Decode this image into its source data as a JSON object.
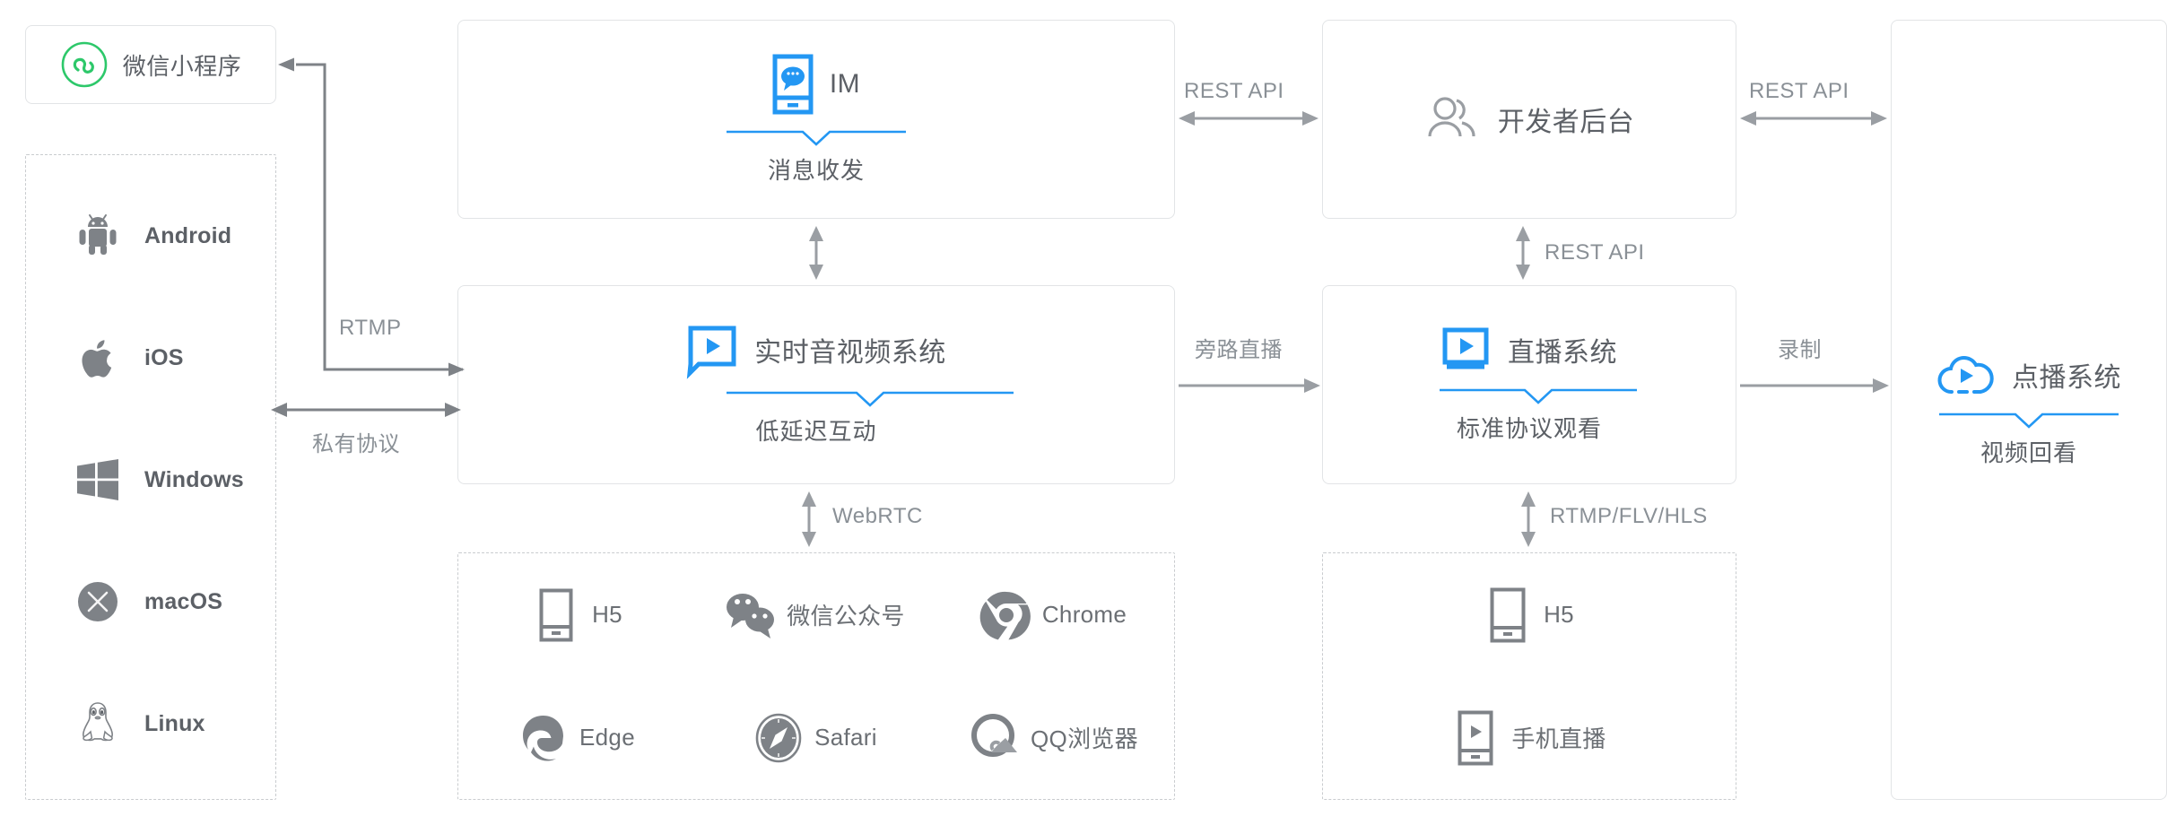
{
  "wechat_mini": {
    "label": "微信小程序",
    "icon": "wechat-miniprogram-icon",
    "accent": "#2dc86a"
  },
  "platforms": [
    {
      "label": "Android",
      "icon": "android-icon"
    },
    {
      "label": "iOS",
      "icon": "apple-icon"
    },
    {
      "label": "Windows",
      "icon": "windows-icon"
    },
    {
      "label": "macOS",
      "icon": "macos-icon"
    },
    {
      "label": "Linux",
      "icon": "linux-icon"
    }
  ],
  "modules": {
    "im": {
      "title": "IM",
      "subtitle": "消息收发",
      "icon": "im-phone-chat-icon"
    },
    "rtc": {
      "title": "实时音视频系统",
      "subtitle": "低延迟互动",
      "icon": "rtc-play-bubble-icon"
    },
    "dev": {
      "title": "开发者后台",
      "subtitle": "",
      "icon": "users-icon"
    },
    "live": {
      "title": "直播系统",
      "subtitle": "标准协议观看",
      "icon": "live-play-icon"
    },
    "vod": {
      "title": "点播系统",
      "subtitle": "视频回看",
      "icon": "cloud-play-icon"
    }
  },
  "browser_clients": [
    {
      "label": "H5",
      "icon": "phone-icon"
    },
    {
      "label": "微信公众号",
      "icon": "wechat-official-icon"
    },
    {
      "label": "Chrome",
      "icon": "chrome-icon"
    },
    {
      "label": "Edge",
      "icon": "edge-icon"
    },
    {
      "label": "Safari",
      "icon": "safari-icon"
    },
    {
      "label": "QQ浏览器",
      "icon": "qq-browser-icon"
    }
  ],
  "mobile_clients": [
    {
      "label": "H5",
      "icon": "phone-icon"
    },
    {
      "label": "手机直播",
      "icon": "phone-live-icon"
    }
  ],
  "connectors": {
    "rtmp": "RTMP",
    "private_protocol": "私有协议",
    "im_dev_rest": "REST API",
    "dev_vod_rest": "REST API",
    "dev_live_rest": "REST API",
    "bypass_live": "旁路直播",
    "record": "录制",
    "webrtc": "WebRTC",
    "rtmp_flv_hls": "RTMP/FLV/HLS"
  },
  "colors": {
    "accent_blue": "#2397f3",
    "wechat_green": "#2dc86a",
    "text_gray": "#5c6066",
    "line_gray": "#8a9096",
    "border_gray": "#e2e4e6",
    "dashed_gray": "#c9cccf"
  }
}
